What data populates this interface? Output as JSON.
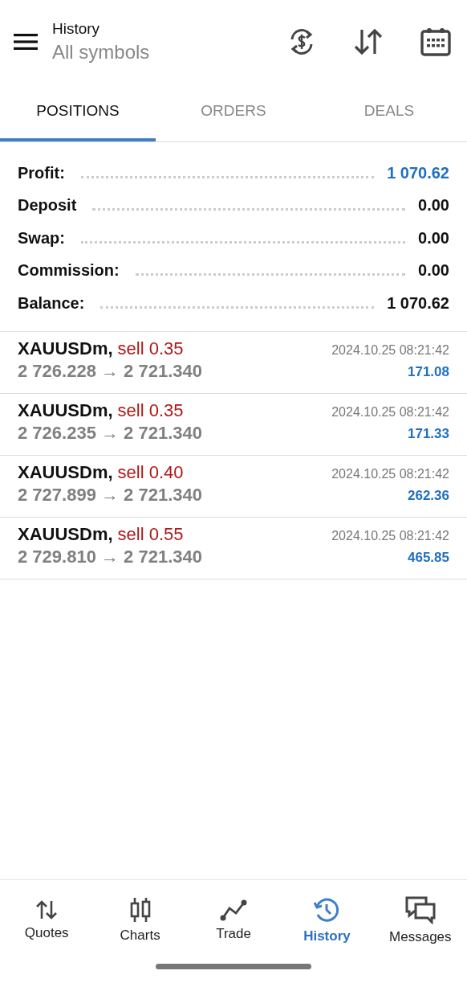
{
  "header": {
    "title": "History",
    "subtitle": "All symbols"
  },
  "tabs": [
    {
      "label": "POSITIONS",
      "selected": true
    },
    {
      "label": "ORDERS",
      "selected": false
    },
    {
      "label": "DEALS",
      "selected": false
    }
  ],
  "summary": [
    {
      "label": "Profit:",
      "value": "1 070.62",
      "color": "#1f6fc0"
    },
    {
      "label": "Deposit",
      "value": "0.00",
      "color": "#111111"
    },
    {
      "label": "Swap:",
      "value": "0.00",
      "color": "#111111"
    },
    {
      "label": "Commission:",
      "value": "0.00",
      "color": "#111111"
    },
    {
      "label": "Balance:",
      "value": "1 070.62",
      "color": "#111111"
    }
  ],
  "deals": [
    {
      "symbol": "XAUUSDm,",
      "trade": "sell 0.35",
      "prices": "2 726.228 → 2 721.340",
      "time": "2024.10.25 08:21:42",
      "profit": "171.08"
    },
    {
      "symbol": "XAUUSDm,",
      "trade": "sell 0.35",
      "prices": "2 726.235 → 2 721.340",
      "time": "2024.10.25 08:21:42",
      "profit": "171.33"
    },
    {
      "symbol": "XAUUSDm,",
      "trade": "sell 0.40",
      "prices": "2 727.899 → 2 721.340",
      "time": "2024.10.25 08:21:42",
      "profit": "262.36"
    },
    {
      "symbol": "XAUUSDm,",
      "trade": "sell 0.55",
      "prices": "2 729.810 → 2 721.340",
      "time": "2024.10.25 08:21:42",
      "profit": "465.85"
    }
  ],
  "nav": [
    {
      "label": "Quotes",
      "kind": "quotes",
      "selected": false
    },
    {
      "label": "Charts",
      "kind": "charts",
      "selected": false
    },
    {
      "label": "Trade",
      "kind": "trade",
      "selected": false
    },
    {
      "label": "History",
      "kind": "history",
      "selected": true
    },
    {
      "label": "Messages",
      "kind": "messages",
      "selected": false
    }
  ]
}
